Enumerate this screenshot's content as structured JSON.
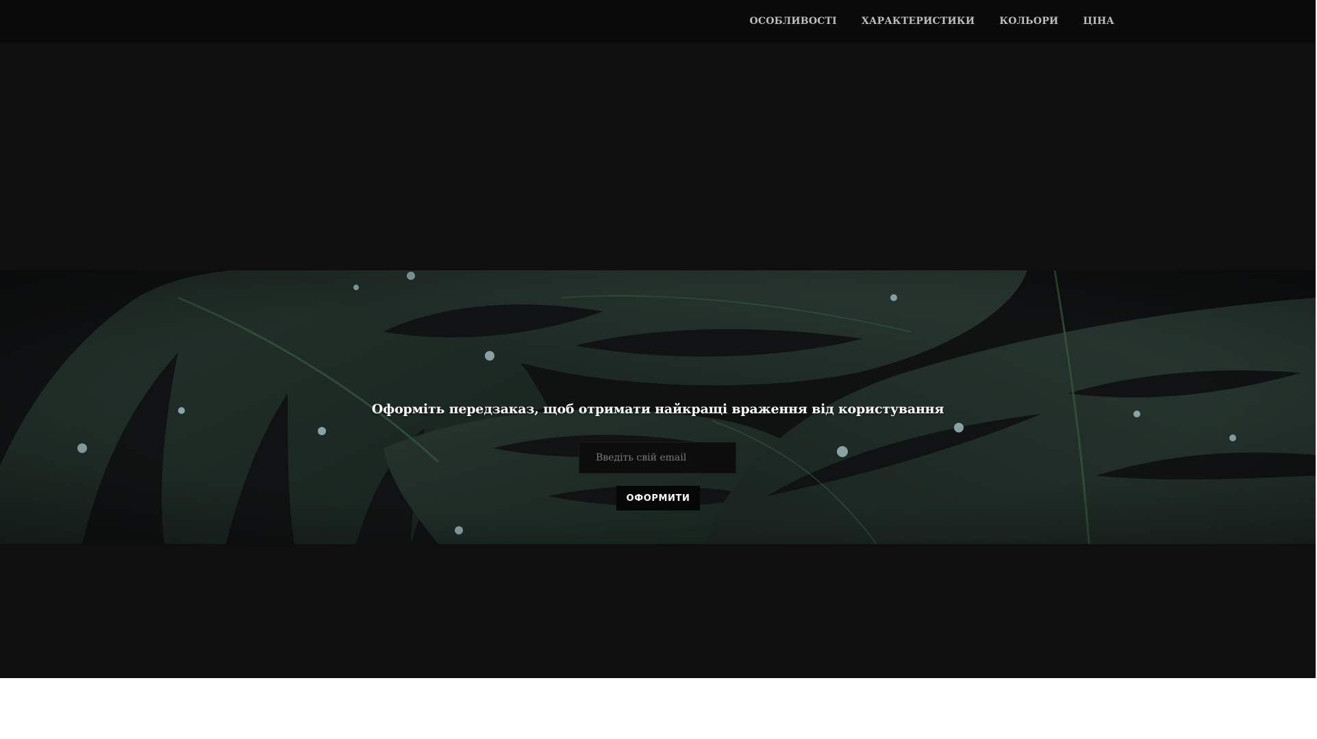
{
  "nav": {
    "items": [
      {
        "label": "ОСОБЛИВОСТІ"
      },
      {
        "label": "ХАРАКТЕРИСТИКИ"
      },
      {
        "label": "КОЛЬОРИ"
      },
      {
        "label": "ЦІНА"
      }
    ]
  },
  "preorder": {
    "heading": "Оформіть передзаказ, щоб отримати найкращі враження від користування",
    "email_placeholder": "Введіть свій email",
    "submit_label": "ОФОРМИТИ"
  },
  "colors": {
    "page_background": "#0f0f0f",
    "navbar_background": "#0a0a0a",
    "nav_text": "#bdbdbd",
    "leaf_green": "#2a3a32",
    "button_background": "#060606"
  },
  "background_image": {
    "icon": "monstera-leaves-photo"
  }
}
